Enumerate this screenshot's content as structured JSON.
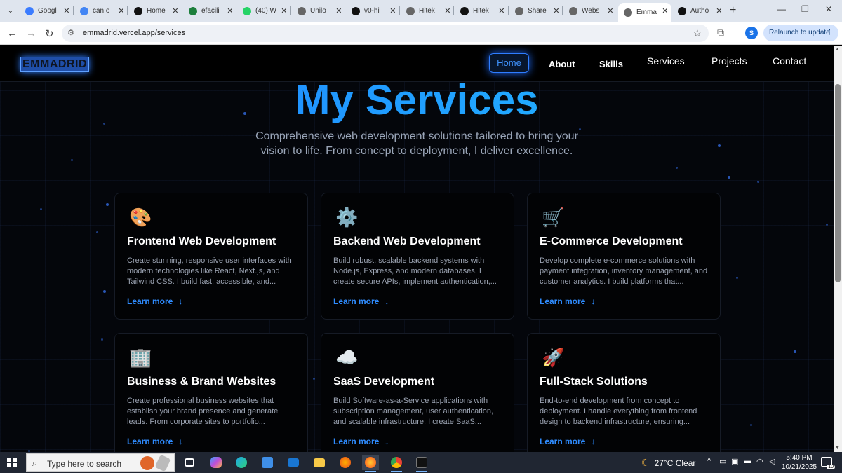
{
  "browser": {
    "tabs": [
      {
        "label": "Googl",
        "icon": "gemini-icon",
        "color": "#3b7cff"
      },
      {
        "label": "can o",
        "icon": "google-icon",
        "color": "#4285f4"
      },
      {
        "label": "Home",
        "icon": "notion-like-icon",
        "color": "#111111"
      },
      {
        "label": "efacili",
        "icon": "efacility-icon",
        "color": "#1d7f3c"
      },
      {
        "label": "(40) W",
        "icon": "whatsapp-icon",
        "color": "#25d366"
      },
      {
        "label": "Unilo",
        "icon": "globe-icon",
        "color": "#666666"
      },
      {
        "label": "v0-hi",
        "icon": "vercel-icon",
        "color": "#111111"
      },
      {
        "label": "Hitek",
        "icon": "globe-icon",
        "color": "#666666"
      },
      {
        "label": "Hitek",
        "icon": "v0-icon",
        "color": "#111111"
      },
      {
        "label": "Share",
        "icon": "globe-icon",
        "color": "#666666"
      },
      {
        "label": "Webs",
        "icon": "web-icon",
        "color": "#666666"
      },
      {
        "label": "Emma",
        "icon": "globe-icon",
        "color": "#666666",
        "active": true
      },
      {
        "label": "Autho",
        "icon": "vercel-icon",
        "color": "#111111"
      }
    ],
    "url": "emmadrid.vercel.app/services",
    "profile_initial": "S",
    "relaunch_label": "Relaunch to update"
  },
  "site": {
    "brand": "EMMADRID",
    "nav": [
      "Home",
      "About",
      "Skills",
      "Services",
      "Projects",
      "Contact"
    ],
    "hero": {
      "title": "My Services",
      "subtitle": "Comprehensive web development solutions tailored to bring your vision to life. From concept to deployment, I deliver excellence."
    },
    "cards": [
      {
        "icon": "palette-icon",
        "emoji": "🎨",
        "title": "Frontend Web Development",
        "desc": "Create stunning, responsive user interfaces with modern technologies like React, Next.js, and Tailwind CSS. I build fast, accessible, and...",
        "link": "Learn more"
      },
      {
        "icon": "gear-icon",
        "emoji": "⚙️",
        "title": "Backend Web Development",
        "desc": "Build robust, scalable backend systems with Node.js, Express, and modern databases. I create secure APIs, implement authentication,...",
        "link": "Learn more"
      },
      {
        "icon": "shopping-cart-icon",
        "emoji": "🛒",
        "title": "E-Commerce Development",
        "desc": "Develop complete e-commerce solutions with payment integration, inventory management, and customer analytics. I build platforms that...",
        "link": "Learn more"
      },
      {
        "icon": "office-building-icon",
        "emoji": "🏢",
        "title": "Business & Brand Websites",
        "desc": "Create professional business websites that establish your brand presence and generate leads. From corporate sites to portfolio...",
        "link": "Learn more"
      },
      {
        "icon": "cloud-icon",
        "emoji": "☁️",
        "title": "SaaS Development",
        "desc": "Build Software-as-a-Service applications with subscription management, user authentication, and scalable infrastructure. I create SaaS...",
        "link": "Learn more"
      },
      {
        "icon": "rocket-icon",
        "emoji": "🚀",
        "title": "Full-Stack Solutions",
        "desc": "End-to-end development from concept to deployment. I handle everything from frontend design to backend infrastructure, ensuring...",
        "link": "Learn more"
      }
    ]
  },
  "taskbar": {
    "search_placeholder": "Type here to search",
    "weather": "27°C  Clear",
    "time": "5:40 PM",
    "date": "10/21/2025",
    "notifications": "10"
  }
}
